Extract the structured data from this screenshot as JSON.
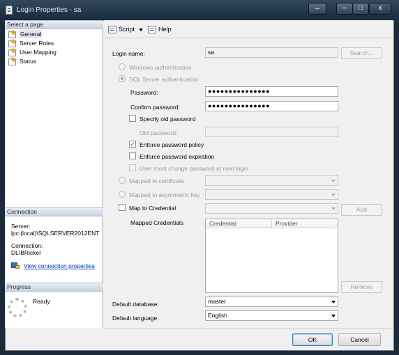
{
  "window": {
    "title": "Login Properties - sa",
    "restore_glyph": "↔",
    "min_glyph": "–",
    "max_glyph": "□",
    "close_glyph": "x"
  },
  "left": {
    "select_page_header": "Select a page",
    "pages": [
      {
        "label": "General",
        "icon": "wrench-page-icon"
      },
      {
        "label": "Server Roles",
        "icon": "wrench-page-icon"
      },
      {
        "label": "User Mapping",
        "icon": "wrench-page-icon"
      },
      {
        "label": "Status",
        "icon": "wrench-page-icon"
      }
    ],
    "connection_header": "Connection",
    "server_label": "Server:",
    "server_value": "lpc:(local)\\SQLSERVER2012ENT",
    "connection_label": "Connection:",
    "connection_value": "DL\\BRicker",
    "view_connection_link": "View connection properties",
    "progress_header": "Progress",
    "progress_status": "Ready"
  },
  "toolbar": {
    "script_label": "Script",
    "help_label": "Help"
  },
  "form": {
    "login_name_label": "Login name:",
    "login_name_value": "sa",
    "search_button": "Search...",
    "windows_auth_label": "Windows authentication",
    "sql_auth_label": "SQL Server authentication",
    "password_label": "Password:",
    "password_value": "●●●●●●●●●●●●●●●",
    "confirm_password_label": "Confirm password:",
    "confirm_password_value": "●●●●●●●●●●●●●●●",
    "specify_old_password_label": "Specify old password",
    "old_password_label": "Old password:",
    "enforce_policy_label": "Enforce password policy",
    "enforce_policy_checked": true,
    "enforce_expiration_label": "Enforce password expiration",
    "enforce_expiration_checked": false,
    "must_change_label": "User must change password at next login",
    "mapped_certificate_label": "Mapped to certificate",
    "mapped_asym_key_label": "Mapped to asymmetric key",
    "map_credential_label": "Map to Credential",
    "add_button": "Add",
    "mapped_credentials_label": "Mapped Credentials",
    "credentials_columns": [
      "Credential",
      "Provider"
    ],
    "remove_button": "Remove",
    "default_database_label": "Default database:",
    "default_database_value": "master",
    "default_language_label": "Default language:",
    "default_language_value": "English",
    "ok_button": "OK",
    "cancel_button": "Cancel",
    "check_glyph": "✓"
  }
}
